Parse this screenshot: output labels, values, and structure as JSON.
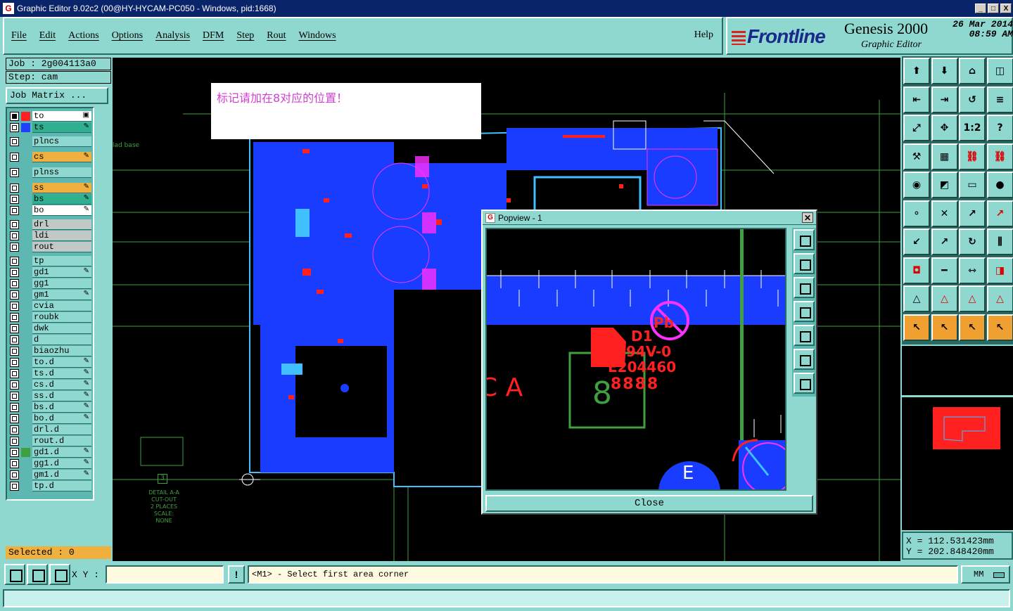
{
  "window": {
    "title": "Graphic Editor 9.02c2 (00@HY-HYCAM-PC050 - Windows, pid:1668)",
    "minimize": "_",
    "maximize": "□",
    "close": "X"
  },
  "menu": {
    "items": [
      "File",
      "Edit",
      "Actions",
      "Options",
      "Analysis",
      "DFM",
      "Step",
      "Rout",
      "Windows"
    ],
    "help": "Help"
  },
  "brand": {
    "logo": "Frontline",
    "product": "Genesis 2000",
    "subtitle": "Graphic Editor",
    "date": "26 Mar 2014",
    "time": "08:59 AM"
  },
  "job": {
    "job_label": "Job : 2g004113a0",
    "step_label": "Step: cam",
    "matrix_button": "Job Matrix ..."
  },
  "layers": [
    {
      "name": "to",
      "color": "#ff2020",
      "nameBg": "#ffffff",
      "pen": "▣",
      "checked": true
    },
    {
      "name": "ts",
      "color": "#2040ff",
      "nameBg": "#30b090",
      "pen": "✎",
      "checked": false
    },
    {
      "name": "plncs",
      "color": "",
      "nameBg": "#8fd8d0",
      "pen": "",
      "checked": false
    },
    {
      "name": "cs",
      "color": "",
      "nameBg": "#f0b040",
      "pen": "✎",
      "checked": false
    },
    {
      "name": "plnss",
      "color": "",
      "nameBg": "#8fd8d0",
      "pen": "",
      "checked": false
    },
    {
      "name": "ss",
      "color": "",
      "nameBg": "#f0b040",
      "pen": "✎",
      "checked": false
    },
    {
      "name": "bs",
      "color": "",
      "nameBg": "#30b090",
      "pen": "✎",
      "checked": false
    },
    {
      "name": "bo",
      "color": "",
      "nameBg": "#ffffff",
      "pen": "✎",
      "checked": false
    },
    {
      "name": "drl",
      "color": "",
      "nameBg": "#c0c8c8",
      "pen": "",
      "checked": false
    },
    {
      "name": "ldi",
      "color": "",
      "nameBg": "#c0c8c8",
      "pen": "",
      "checked": false
    },
    {
      "name": "rout",
      "color": "",
      "nameBg": "#c0c8c8",
      "pen": "",
      "checked": false
    },
    {
      "name": "tp",
      "color": "",
      "nameBg": "#8fd8d0",
      "pen": "",
      "checked": false
    },
    {
      "name": "gd1",
      "color": "",
      "nameBg": "#8fd8d0",
      "pen": "✎",
      "checked": false
    },
    {
      "name": "gg1",
      "color": "",
      "nameBg": "#8fd8d0",
      "pen": "",
      "checked": false
    },
    {
      "name": "gm1",
      "color": "",
      "nameBg": "#8fd8d0",
      "pen": "✎",
      "checked": false
    },
    {
      "name": "cvia",
      "color": "",
      "nameBg": "#8fd8d0",
      "pen": "",
      "checked": false
    },
    {
      "name": "roubk",
      "color": "",
      "nameBg": "#8fd8d0",
      "pen": "",
      "checked": false
    },
    {
      "name": "dwk",
      "color": "",
      "nameBg": "#8fd8d0",
      "pen": "",
      "checked": false
    },
    {
      "name": "d",
      "color": "",
      "nameBg": "#8fd8d0",
      "pen": "",
      "checked": false
    },
    {
      "name": "biaozhu",
      "color": "",
      "nameBg": "#8fd8d0",
      "pen": "",
      "checked": false
    },
    {
      "name": "to.d",
      "color": "",
      "nameBg": "#8fd8d0",
      "pen": "✎",
      "checked": false
    },
    {
      "name": "ts.d",
      "color": "",
      "nameBg": "#8fd8d0",
      "pen": "✎",
      "checked": false
    },
    {
      "name": "cs.d",
      "color": "",
      "nameBg": "#8fd8d0",
      "pen": "✎",
      "checked": false
    },
    {
      "name": "ss.d",
      "color": "",
      "nameBg": "#8fd8d0",
      "pen": "✎",
      "checked": false
    },
    {
      "name": "bs.d",
      "color": "",
      "nameBg": "#8fd8d0",
      "pen": "✎",
      "checked": false
    },
    {
      "name": "bo.d",
      "color": "",
      "nameBg": "#8fd8d0",
      "pen": "✎",
      "checked": false
    },
    {
      "name": "drl.d",
      "color": "",
      "nameBg": "#8fd8d0",
      "pen": "",
      "checked": false
    },
    {
      "name": "rout.d",
      "color": "",
      "nameBg": "#8fd8d0",
      "pen": "",
      "checked": false
    },
    {
      "name": "gd1.d",
      "color": "#40a040",
      "nameBg": "#8fd8d0",
      "pen": "✎",
      "checked": false
    },
    {
      "name": "gg1.d",
      "color": "",
      "nameBg": "#8fd8d0",
      "pen": "✎",
      "checked": false
    },
    {
      "name": "gm1.d",
      "color": "",
      "nameBg": "#8fd8d0",
      "pen": "✎",
      "checked": false
    },
    {
      "name": "tp.d",
      "color": "",
      "nameBg": "#8fd8d0",
      "pen": "",
      "checked": false
    }
  ],
  "selected": "Selected : 0",
  "note": "标记请加在8对应的位置！",
  "canvas_texts": {
    "lad_base": "lad base",
    "detail": "DETAIL A-A",
    "cutout": "CUT-OUT",
    "places": "2 PLACES",
    "scale": "SCALE: NONE",
    "marker": "3"
  },
  "popview": {
    "title": "Popview - 1",
    "close_label": "Close",
    "texts": {
      "d1": "D1",
      "v0": "94V-0",
      "ul": "E204460",
      "eights": "8888",
      "big8": "8",
      "ca": "C  A",
      "e": "E",
      "pb": "Pb"
    }
  },
  "coords": {
    "x": "X  =  112.531423mm",
    "y": "Y  =  202.848420mm"
  },
  "bottom": {
    "xy_label": "X Y :",
    "xy_value": "",
    "excl": "!",
    "prompt": "<M1> - Select first area corner",
    "units": "MM"
  },
  "tool_labels": [
    "1:2",
    "?"
  ],
  "colors": {
    "bg": "#8fd8d0",
    "copper": "#1a3cff",
    "pad": "#ff2020",
    "mask": "#ff30ff",
    "trace": "#40c0ff",
    "silk": "#40a040"
  }
}
